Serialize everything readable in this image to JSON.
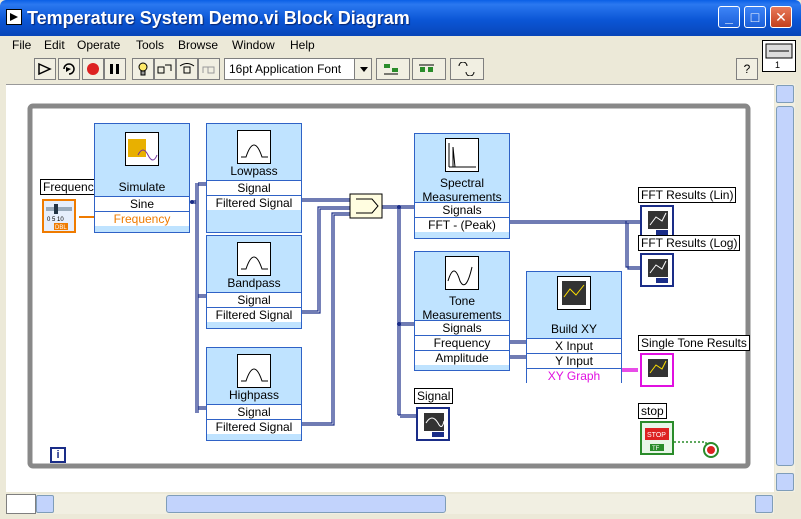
{
  "window": {
    "title": "Temperature System Demo.vi Block Diagram",
    "minimize_label": "_",
    "maximize_label": "□",
    "close_label": "✕"
  },
  "menu": {
    "items": [
      "File",
      "Edit",
      "Operate",
      "Tools",
      "Browse",
      "Window",
      "Help"
    ]
  },
  "toolbar": {
    "font_label": "16pt Application Font",
    "help_label": "?",
    "buttons": [
      "run-arrow-icon",
      "run-continuously-icon",
      "abort-icon",
      "pause-icon",
      "highlight-execution-icon",
      "step-into-icon",
      "step-over-icon",
      "step-out-icon"
    ]
  },
  "diagram": {
    "simulate": {
      "title": "Simulate",
      "rows": [
        "Sine",
        "Frequency"
      ]
    },
    "lowpass": {
      "title": "Lowpass",
      "rows": [
        "Signal",
        "Filtered Signal"
      ]
    },
    "bandpass": {
      "title": "Bandpass",
      "rows": [
        "Signal",
        "Filtered Signal"
      ]
    },
    "highpass": {
      "title": "Highpass",
      "rows": [
        "Signal",
        "Filtered Signal"
      ]
    },
    "spectral": {
      "title": "Spectral Measurements",
      "rows": [
        "Signals",
        "FFT - (Peak)"
      ]
    },
    "tone": {
      "title": "Tone Measurements",
      "rows": [
        "Signals",
        "Frequency",
        "Amplitude"
      ]
    },
    "buildxy": {
      "title": "Build XY",
      "rows": [
        "X Input",
        "Y Input",
        "XY Graph"
      ]
    },
    "labels": {
      "frequency": "Frequency",
      "fft_lin": "FFT Results (Lin)",
      "fft_log": "FFT Results (Log)",
      "single_tone": "Single Tone Results",
      "signal": "Signal",
      "stop": "stop",
      "info": "i"
    },
    "terminals": {
      "frequency_badge": "DBL",
      "frequency_scale": "0 5 10",
      "stop_button": "STOP",
      "stop_badge": "TF"
    }
  },
  "colors": {
    "wire_blue": "#1a2d88",
    "wire_pink": "#e010e0",
    "wire_orange": "#ef7b00",
    "node_blue": "#bfe3ff",
    "express_border": "#2f62c6"
  }
}
